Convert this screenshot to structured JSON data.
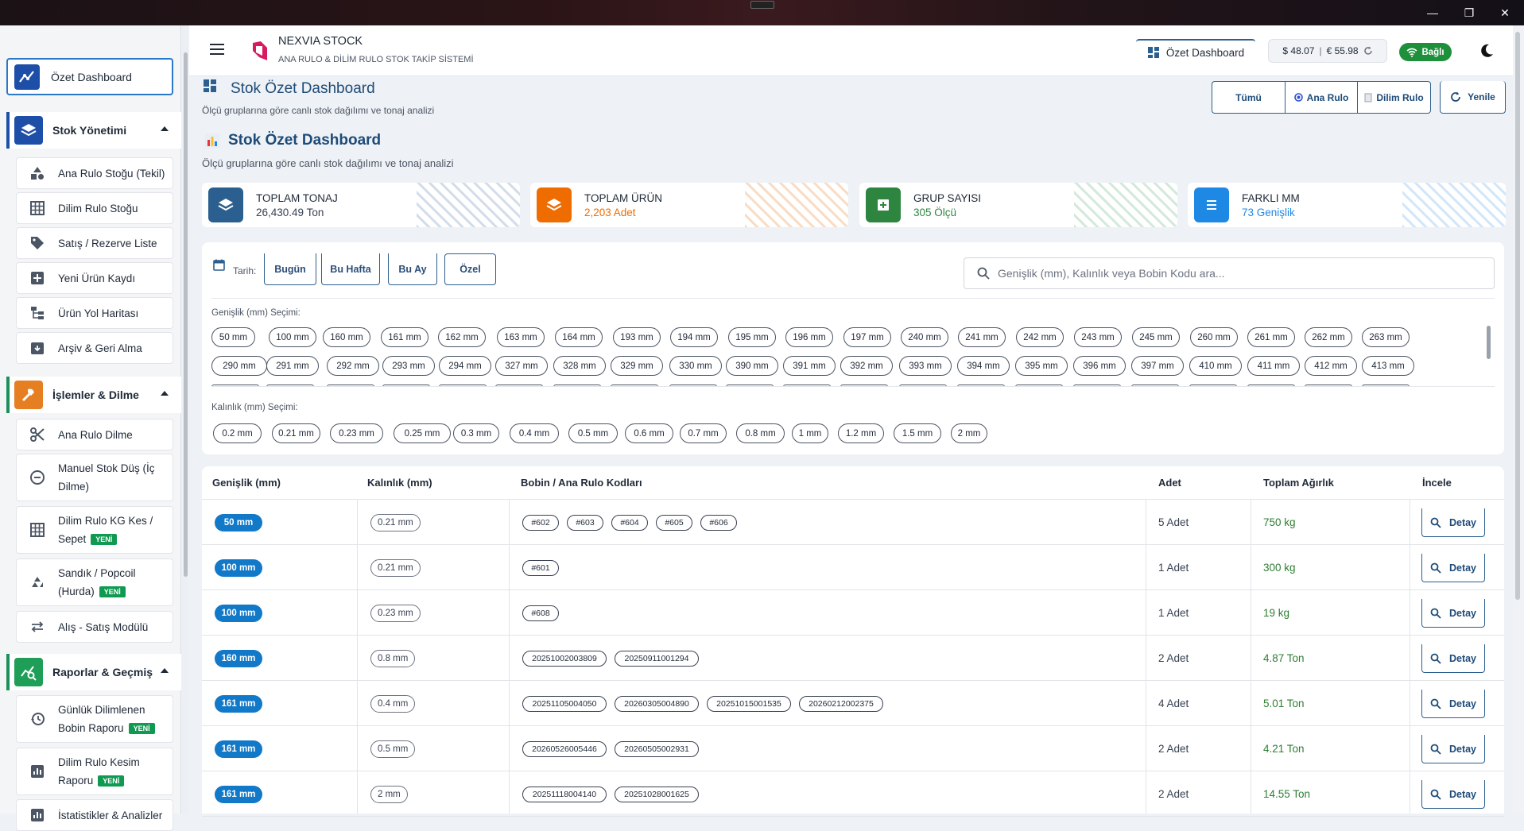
{
  "app": {
    "name": "NEXVIA STOCK",
    "subtitle": "ANA RULO & DİLİM RULO STOK TAKİP SİSTEMİ"
  },
  "header": {
    "active_page": "Özet Dashboard",
    "usd": "$ 48.07",
    "eur": "€ 55.98",
    "separator": "|",
    "status": "Bağlı"
  },
  "sidebar": {
    "active": "Özet Dashboard",
    "groups": [
      {
        "title": "Stok Yönetimi",
        "items": [
          "Ana Rulo Stoğu (Tekil)",
          "Dilim Rulo Stoğu",
          "Satış / Rezerve Liste",
          "Yeni Ürün Kaydı",
          "Ürün Yol Haritası",
          "Arşiv & Geri Alma"
        ]
      },
      {
        "title": "İşlemler & Dilme",
        "items": [
          "Ana Rulo Dilme",
          "Manuel Stok Düş (İç",
          "Dilme)",
          "Dilim Rulo KG Kes /",
          "Sepet",
          "Sandık / Popcoil",
          "(Hurda)",
          "Alış - Satış Modülü"
        ]
      },
      {
        "title": "Raporlar & Geçmiş",
        "items": [
          "Günlük Dilimlenen",
          "Bobin Raporu",
          "Dilim Rulo Kesim",
          "Raporu",
          "İstatistikler & Analizler"
        ]
      }
    ],
    "new_badge": "YENİ"
  },
  "page": {
    "title": "Stok Özet Dashboard",
    "desc": "Ölçü gruplarına göre canlı stok dağılımı ve tonaj analizi",
    "title2": "Stok Özet Dashboard",
    "desc2": "Ölçü gruplarına göre canlı stok dağılımı ve tonaj analizi",
    "filters": {
      "all": "Tümü",
      "ana": "Ana Rulo",
      "dilim": "Dilim Rulo",
      "refresh": "Yenile"
    }
  },
  "stats": [
    {
      "label": "TOPLAM TONAJ",
      "value": "26,430.49 Ton",
      "color": "#2b5f8f"
    },
    {
      "label": "TOPLAM ÜRÜN",
      "value": "2,203 Adet",
      "color": "#ef6c00"
    },
    {
      "label": "GRUP SAYISI",
      "value": "305 Ölçü",
      "color": "#2e8540"
    },
    {
      "label": "FARKLI MM",
      "value": "73 Genişlik",
      "color": "#1e88e5"
    }
  ],
  "filter_panel": {
    "date_label": "Tarih:",
    "date_buttons": [
      "Bugün",
      "Bu Hafta",
      "Bu Ay",
      "Özel"
    ],
    "search_placeholder": "Genişlik (mm), Kalınlık veya Bobin Kodu ara...",
    "width_label": "Genişlik (mm) Seçimi:",
    "widths_row1": [
      "50 mm",
      "100 mm",
      "160 mm",
      "161 mm",
      "162 mm",
      "163 mm",
      "164 mm",
      "193 mm",
      "194 mm",
      "195 mm",
      "196 mm",
      "197 mm",
      "240 mm",
      "241 mm",
      "242 mm",
      "243 mm",
      "245 mm",
      "260 mm",
      "261 mm",
      "262 mm",
      "263 mm"
    ],
    "widths_row2": [
      "290 mm",
      "291 mm",
      "292 mm",
      "293 mm",
      "294 mm",
      "327 mm",
      "328 mm",
      "329 mm",
      "330 mm",
      "390 mm",
      "391 mm",
      "392 mm",
      "393 mm",
      "394 mm",
      "395 mm",
      "396 mm",
      "397 mm",
      "410 mm",
      "411 mm",
      "412 mm",
      "413 mm"
    ],
    "thickness_label": "Kalınlık (mm) Seçimi:",
    "thicknesses": [
      "0.2 mm",
      "0.21 mm",
      "0.23 mm",
      "0.25 mm",
      "0.3 mm",
      "0.4 mm",
      "0.5 mm",
      "0.6 mm",
      "0.7 mm",
      "0.8 mm",
      "1 mm",
      "1.2 mm",
      "1.5 mm",
      "2 mm"
    ]
  },
  "table": {
    "headers": [
      "Genişlik (mm)",
      "Kalınlık (mm)",
      "Bobin / Ana Rulo Kodları",
      "Adet",
      "Toplam Ağırlık",
      "İncele"
    ],
    "detail_label": "Detay",
    "rows": [
      {
        "width": "50 mm",
        "thickness": "0.21 mm",
        "codes": [
          "#602",
          "#603",
          "#604",
          "#605",
          "#606"
        ],
        "count": "5 Adet",
        "weight": "750 kg"
      },
      {
        "width": "100 mm",
        "thickness": "0.21 mm",
        "codes": [
          "#601"
        ],
        "count": "1 Adet",
        "weight": "300 kg"
      },
      {
        "width": "100 mm",
        "thickness": "0.23 mm",
        "codes": [
          "#608"
        ],
        "count": "1 Adet",
        "weight": "19 kg"
      },
      {
        "width": "160 mm",
        "thickness": "0.8 mm",
        "codes": [
          "20251002003809",
          "20250911001294"
        ],
        "count": "2 Adet",
        "weight": "4.87 Ton"
      },
      {
        "width": "161 mm",
        "thickness": "0.4 mm",
        "codes": [
          "20251105004050",
          "20260305004890",
          "20251015001535",
          "20260212002375"
        ],
        "count": "4 Adet",
        "weight": "5.01 Ton"
      },
      {
        "width": "161 mm",
        "thickness": "0.5 mm",
        "codes": [
          "20260526005446",
          "20260505002931"
        ],
        "count": "2 Adet",
        "weight": "4.21 Ton"
      },
      {
        "width": "161 mm",
        "thickness": "2 mm",
        "codes": [
          "20251118004140",
          "20251028001625"
        ],
        "count": "2 Adet",
        "weight": "14.55 Ton"
      }
    ]
  }
}
